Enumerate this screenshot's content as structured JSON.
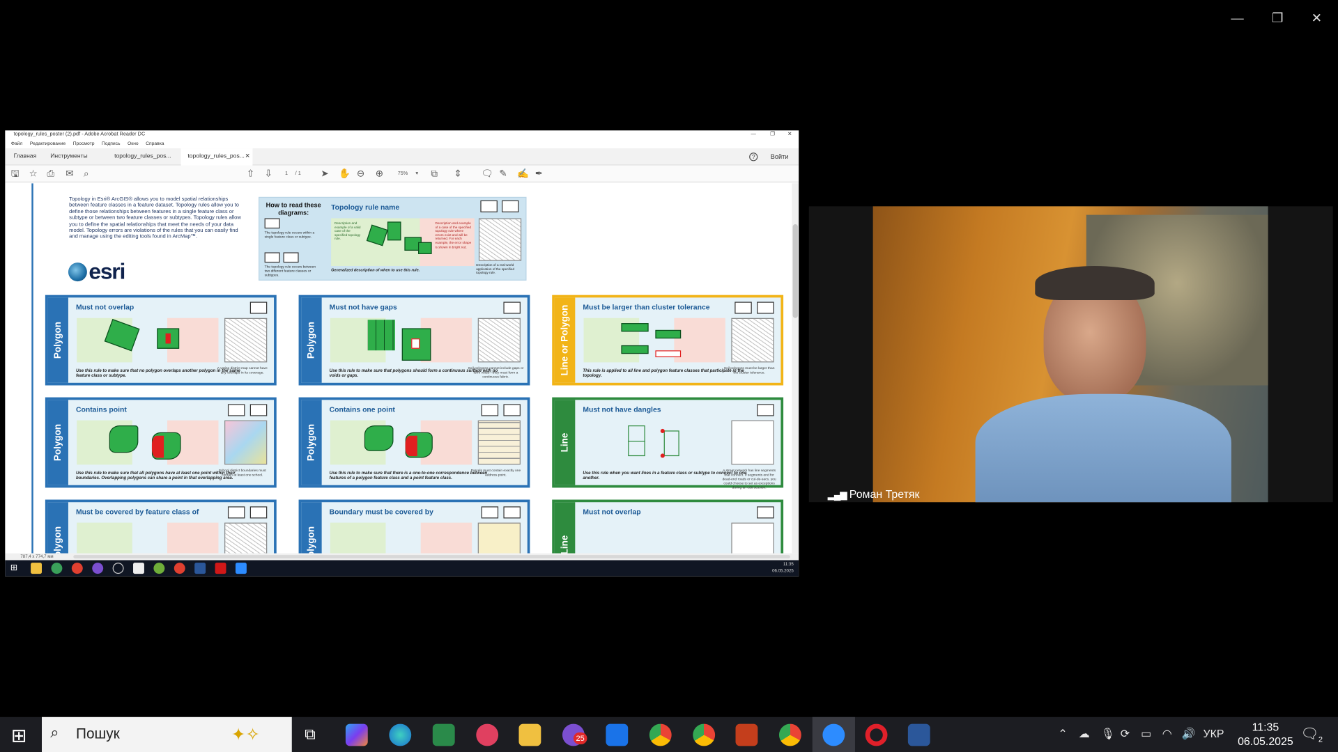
{
  "zoom_controls": {
    "minimize": "—",
    "restore": "❐",
    "close": "✕"
  },
  "acrobat": {
    "title": "topology_rules_poster (2).pdf - Adobe Acrobat Reader DC",
    "menu": [
      "Файл",
      "Редактирование",
      "Просмотр",
      "Подпись",
      "Окно",
      "Справка"
    ],
    "tabs": [
      "Главная",
      "Инструменты",
      "topology_rules_pos...",
      "topology_rules_pos..."
    ],
    "active_tab": 3,
    "help": "?",
    "signin": "Войти",
    "page_current": "1",
    "page_total": "/ 1",
    "zoom": "75%",
    "page_size": "787,4 x 774,7 мм",
    "taskbar_time": "11:35",
    "taskbar_date": "06.05.2025"
  },
  "poster": {
    "intro": "Topology in Esri® ArcGIS® allows you to model spatial relationships between feature classes in a feature dataset. Topology rules allow you to define those relationships between features in a single feature class or subtype or between two feature classes or subtypes. Topology rules allow you to define the spatial relationships that meet the needs of your data model. Topology errors are violations of the rules that you can easily find and manage using the editing tools found in ArcMap™.",
    "logo": "esri",
    "howto": {
      "heading": "How to read these diagrams:",
      "rule_name": "Topology rule name",
      "single_note": "The topology rule occurs within a single feature class or subtype.",
      "two_note": "The topology rule occurs between two different feature classes or subtypes.",
      "valid_note": "Description and example of a valid case of the specified topology rule.",
      "invalid_note": "Description and example of a case of the specified topology rule where errors exist and will be returned. For each example, the error shape is shown in bright red.",
      "real_note": "Description of a real-world application of the specified topology rule.",
      "general": "Generalized description of when to use this rule."
    },
    "cards": [
      {
        "side": "Polygon",
        "title": "Must not overlap",
        "desc": "Use this rule to make sure that no polygon overlaps another polygon in the same feature class or subtype.",
        "note": "A voting district map cannot have any overlaps in its coverage."
      },
      {
        "side": "Polygon",
        "title": "Must not have gaps",
        "desc": "Use this rule to make sure that polygons should form a continuous surface with no voids or gaps.",
        "note": "Soil polygons cannot include gaps or form voids—they must form a continuous fabric."
      },
      {
        "side": "Line or Polygon",
        "title": "Must be larger than cluster tolerance",
        "desc": "This rule is applied to all line and polygon feature classes that participate in the topology.",
        "note": "Soil polygons must be larger than the cluster tolerance."
      },
      {
        "side": "Polygon",
        "title": "Contains point",
        "desc": "Use this rule to make sure that all polygons have at least one point within their boundaries. Overlapping polygons can share a point in that overlapping area.",
        "note": "School district boundaries must contain at least one school."
      },
      {
        "side": "Polygon",
        "title": "Contains one point",
        "desc": "Use this rule to make sure that there is a one-to-one correspondence between features of a polygon feature class and a point feature class.",
        "note": "Parcels must contain exactly one address point."
      },
      {
        "side": "Line",
        "title": "Must not have dangles",
        "desc": "Use this rule when you want lines in a feature class or subtype to connect to one another.",
        "note": "A street network has line segments that connect. If segments end for dead-end roads or cul-de-sacs, you could choose to set as exceptions during an edit session."
      },
      {
        "side": "Polygon",
        "title": "Must be covered by feature class of",
        "desc": "",
        "note": ""
      },
      {
        "side": "Polygon",
        "title": "Boundary must be covered by",
        "desc": "",
        "note": ""
      },
      {
        "side": "Line",
        "title": "Must not overlap",
        "desc": "",
        "note": ""
      }
    ]
  },
  "video": {
    "participant": "Роман Третяк"
  },
  "taskbar": {
    "search_placeholder": "Пошук",
    "notification_badge": "25",
    "lang": "УКР",
    "time": "11:35",
    "date": "06.05.2025",
    "action_center_count": "2"
  }
}
